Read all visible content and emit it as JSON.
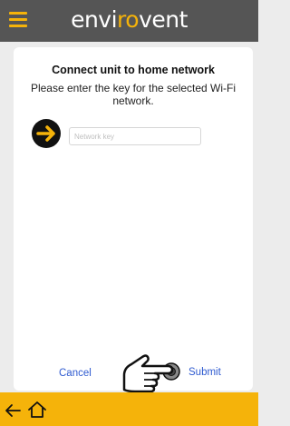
{
  "header": {
    "menu_icon": "hamburger-icon",
    "brand_part1": "envi",
    "brand_part2": "ro",
    "brand_part3": "vent",
    "accent_color": "#f5b30a",
    "bar_color": "#555555"
  },
  "dialog": {
    "title": "Connect unit to home network",
    "message": "Please enter the key for the selected Wi-Fi network.",
    "go_icon": "arrow-right-icon",
    "key_field": {
      "value": "",
      "placeholder": "Network key"
    },
    "cancel_label": "Cancel",
    "submit_label": "Submit",
    "pointer_icon": "pointing-hand-icon"
  },
  "navbar": {
    "back_icon": "arrow-left-icon",
    "home_icon": "home-icon"
  }
}
